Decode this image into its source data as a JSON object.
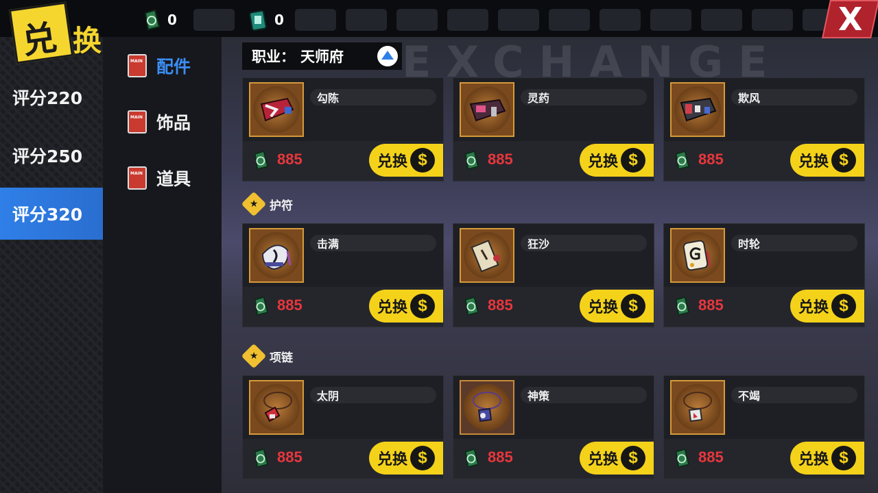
{
  "header": {
    "title_part1": "兑",
    "title_part2": "换",
    "currencies": [
      {
        "icon": "green-token-icon",
        "value": "0"
      },
      {
        "icon": "teal-ticket-icon",
        "value": "0"
      }
    ],
    "close_label": "X"
  },
  "ratings": [
    {
      "label": "评分220",
      "active": false
    },
    {
      "label": "评分250",
      "active": false
    },
    {
      "label": "评分320",
      "active": true
    }
  ],
  "categories": [
    {
      "label": "配件",
      "active": true
    },
    {
      "label": "饰品",
      "active": false
    },
    {
      "label": "道具",
      "active": false
    }
  ],
  "job_filter": {
    "label": "职业：",
    "value": "天师府"
  },
  "background_text": "EXCHANGE",
  "sections": [
    {
      "title": "护符"
    },
    {
      "title": "项链"
    }
  ],
  "items": [
    {
      "name": "勾陈",
      "price": "885",
      "buy": "兑换",
      "icon": "red-bracelet-icon"
    },
    {
      "name": "灵药",
      "price": "885",
      "buy": "兑换",
      "icon": "purple-bracelet-icon"
    },
    {
      "name": "欺风",
      "price": "885",
      "buy": "兑换",
      "icon": "dark-bracelet-icon"
    },
    {
      "name": "击满",
      "price": "885",
      "buy": "兑换",
      "icon": "talisman-bag-icon"
    },
    {
      "name": "狂沙",
      "price": "885",
      "buy": "兑换",
      "icon": "paper-talisman-icon"
    },
    {
      "name": "时轮",
      "price": "885",
      "buy": "兑换",
      "icon": "g-talisman-icon"
    },
    {
      "name": "太阴",
      "price": "885",
      "buy": "兑换",
      "icon": "red-pendant-icon"
    },
    {
      "name": "神策",
      "price": "885",
      "buy": "兑换",
      "icon": "blue-pendant-icon"
    },
    {
      "name": "不竭",
      "price": "885",
      "buy": "兑换",
      "icon": "red-gem-pendant-icon"
    }
  ],
  "colors": {
    "accent_blue": "#2f7fe8",
    "buy_yellow": "#f4d21a",
    "price_red": "#e8373c"
  }
}
